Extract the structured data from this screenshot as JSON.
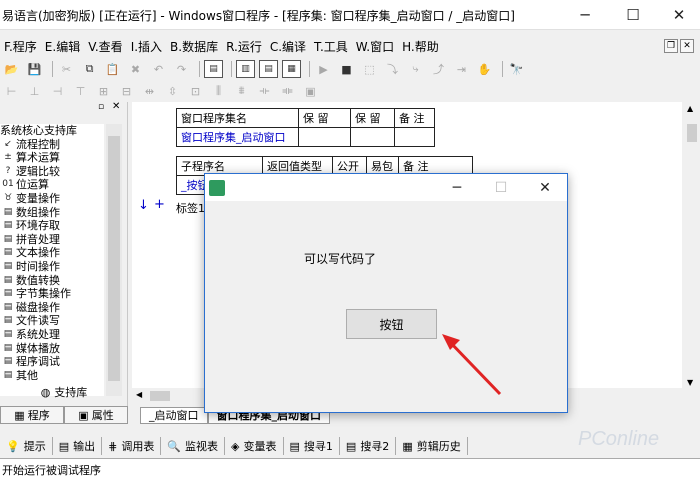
{
  "window": {
    "title": "易语言(加密狗版) [正在运行] - Windows窗口程序 - [程序集: 窗口程序集_启动窗口 / _启动窗口]",
    "minimize": "─",
    "maximize": "☐",
    "close": "✕"
  },
  "menu": {
    "items": [
      "F.程序",
      "E.编辑",
      "V.查看",
      "I.插入",
      "B.数据库",
      "R.运行",
      "C.编译",
      "T.工具",
      "W.窗口",
      "H.帮助"
    ]
  },
  "left_panel": {
    "tree_root": "系统核心支持库",
    "tree_items": [
      "流程控制",
      "算术运算",
      "逻辑比较",
      "位运算",
      "变量操作",
      "数组操作",
      "环境存取",
      "拼音处理",
      "文本操作",
      "时间操作",
      "数值转换",
      "字节集操作",
      "磁盘操作",
      "文件读写",
      "系统处理",
      "媒体播放",
      "程序调试",
      "其他"
    ],
    "support_lib": "支持库",
    "tab_program": "程序",
    "tab_property": "属性"
  },
  "editor": {
    "assembly_table": {
      "headers": [
        "窗口程序集名",
        "保 留",
        "保 留",
        "备 注"
      ],
      "row": [
        "窗口程序集_启动窗口",
        "",
        "",
        ""
      ]
    },
    "sub_table": {
      "headers": [
        "子程序名",
        "返回值类型",
        "公开",
        "易包",
        "备 注"
      ],
      "row": [
        "_按钮",
        "",
        "",
        "",
        ""
      ]
    },
    "code_line": "标签1",
    "tabs": [
      "_启动窗口",
      "窗口程序集_启动窗口"
    ]
  },
  "bottom_tabs": [
    "提示",
    "输出",
    "调用表",
    "监视表",
    "变量表",
    "搜寻1",
    "搜寻2",
    "剪辑历史"
  ],
  "output_text": "开始运行被调试程序",
  "dialog": {
    "label": "可以写代码了",
    "button": "按钮"
  },
  "watermark": "PConline"
}
